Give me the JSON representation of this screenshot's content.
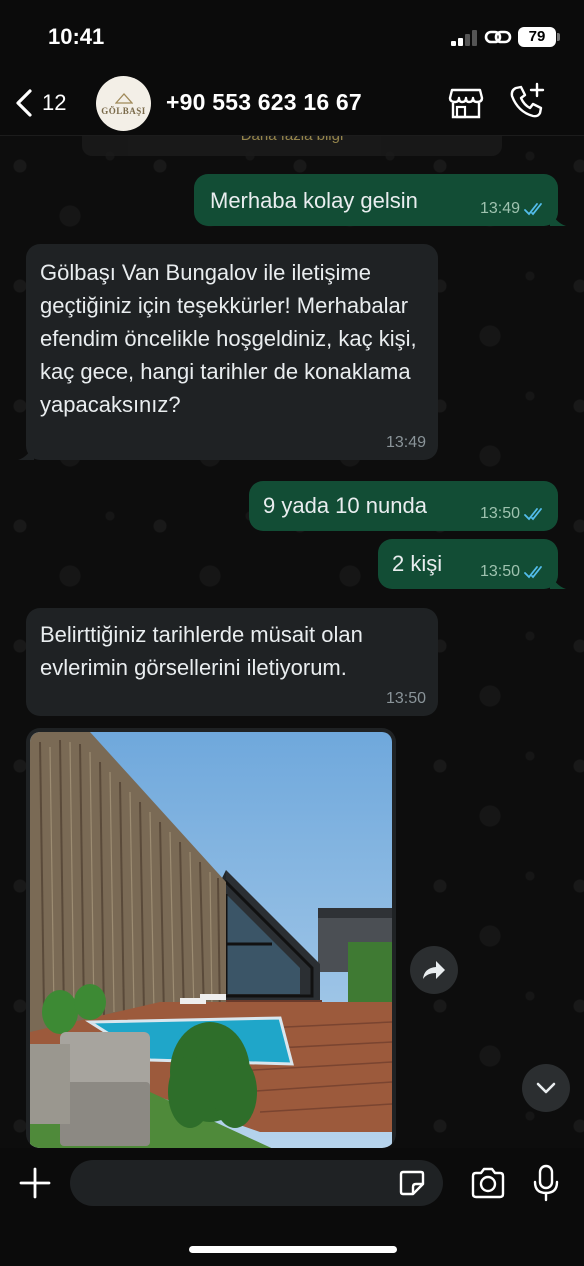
{
  "status_bar": {
    "time": "10:41",
    "battery": "79"
  },
  "header": {
    "back_count": "12",
    "avatar_text": "GÖLBAŞI",
    "contact_name": "+90 553 623 16 67"
  },
  "chat": {
    "top_banner": "Daha fazla bilgi",
    "messages": [
      {
        "direction": "out",
        "text": "Merhaba kolay gelsin",
        "time": "13:49",
        "status": "read"
      },
      {
        "direction": "in",
        "text": "Gölbaşı Van Bungalov ile iletişime geçtiğiniz için teşekkürler! Merhabalar efendim öncelikle hoşgeldiniz, kaç kişi, kaç gece, hangi tarihler de konaklama yapacaksınız?",
        "time": "13:49"
      },
      {
        "direction": "out",
        "text": "9 yada 10 nunda",
        "time": "13:50",
        "status": "read"
      },
      {
        "direction": "out",
        "text": "2 kişi",
        "time": "13:50",
        "status": "read"
      },
      {
        "direction": "in",
        "text": "Belirttiğiniz tarihlerde müsait olan evlerimin görsellerini iletiyorum.",
        "time": "13:50"
      }
    ]
  },
  "input": {
    "placeholder": ""
  },
  "colors": {
    "outgoing_bubble": "#124d35",
    "incoming_bubble": "#1f2224",
    "read_tick": "#53bdeb",
    "background": "#0b0b0b"
  },
  "icons": {
    "back": "chevron-left-icon",
    "store": "store-icon",
    "call": "phone-plus-icon",
    "plus": "plus-icon",
    "sticker": "sticker-icon",
    "camera": "camera-icon",
    "mic": "microphone-icon",
    "forward": "forward-icon",
    "scroll_down": "chevron-down-icon"
  }
}
